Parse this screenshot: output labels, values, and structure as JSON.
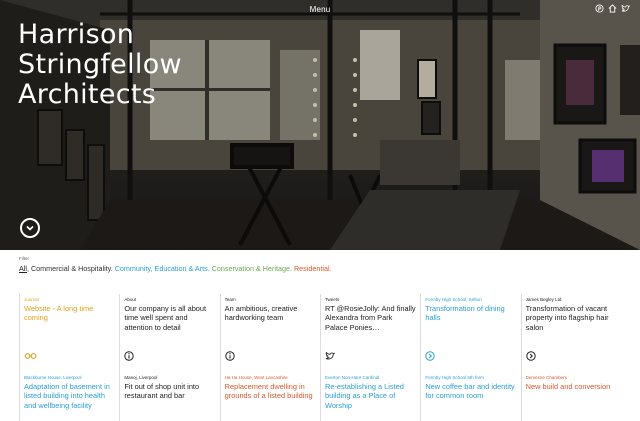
{
  "header": {
    "menu_label": "Menu",
    "site_title_lines": [
      "Harrison",
      "Stringfellow",
      "Architects"
    ]
  },
  "icons": {
    "top": [
      "pinterest-icon",
      "home-icon",
      "twitter-icon"
    ],
    "scroll": "chevron-down-circle-icon"
  },
  "filter": {
    "label": "Filter",
    "options": {
      "all": "All",
      "commercial": ", Commercial & Hospitality. ",
      "community": "Community, Education & Arts. ",
      "conservation": "Conservation & Heritage. ",
      "residential": "Residential."
    }
  },
  "colors": {
    "commercial": "#333333",
    "community": "#2a9fd6",
    "conservation": "#6aaa4f",
    "residential": "#e0572b",
    "journal": "#e0a01e"
  },
  "cards_row1": [
    {
      "meta": "Journal",
      "title": "Website - A long time coming",
      "icon": "glasses-icon"
    },
    {
      "meta": "About",
      "title": "Our company is all about time well spent and attention to detail",
      "icon": "info-icon"
    },
    {
      "meta": "Team",
      "title": "An ambitious, creative hardworking team",
      "icon": "info-icon"
    },
    {
      "meta": "Tweets",
      "title": "RT @RosieJolly: And finally Alexandra from Park Palace Ponies…",
      "icon": "twitter-icon"
    },
    {
      "meta": "Formby High School, Sefton",
      "title": "Transformation of dining halls",
      "icon": "arrow-right-circle-icon"
    },
    {
      "meta": "James Begley Ltd",
      "title": "Transformation of vacant property into flagship hair salon",
      "icon": "arrow-right-circle-icon"
    }
  ],
  "cards_row2": [
    {
      "meta": "Blackburne House, Liverpool",
      "title": "Adaptation of basement in listed building into health and wellbeing facility"
    },
    {
      "meta": "Manoj, Liverpool",
      "title": "Fit out of shop unit into restaurant and bar"
    },
    {
      "meta": "Ha Ha House, West Lancashire",
      "title": "Replacement dwelling in grounds of a listed building"
    },
    {
      "meta": "Everton Non-Hare Cardinal",
      "title": "Re-establishing a Listed building as a Place of Worship"
    },
    {
      "meta": "Formby High School 6th form",
      "title": "New coffee bar and identity for common room"
    },
    {
      "meta": "Demesne Chambers",
      "title": "New build and conversion"
    }
  ]
}
